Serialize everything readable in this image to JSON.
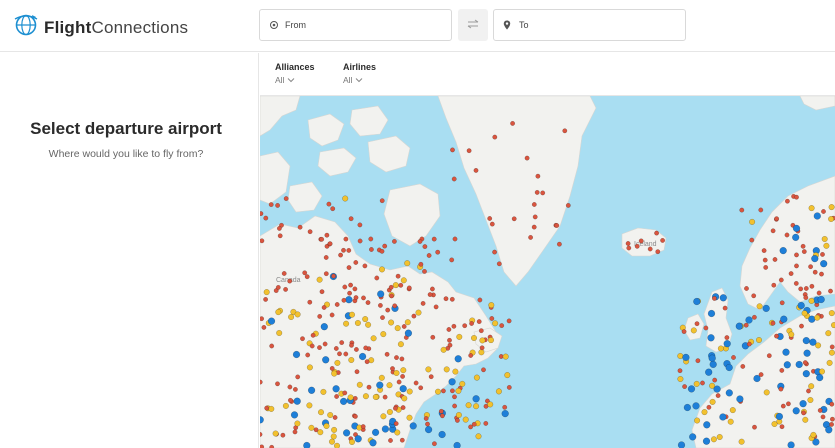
{
  "header": {
    "logo_bold": "Flight",
    "logo_light": "Connections",
    "from_placeholder": "From",
    "to_placeholder": "To"
  },
  "filters": {
    "alliances_label": "Alliances",
    "alliances_value": "All",
    "airlines_label": "Airlines",
    "airlines_value": "All"
  },
  "sidebar": {
    "title": "Select departure airport",
    "subtitle": "Where would you like to fly from?"
  },
  "map": {
    "labels": {
      "canada": "Canada",
      "iceland": "Iceland"
    },
    "colors": {
      "ocean": "#a9def2",
      "land": "#f2f2ef",
      "airport_small": "#d9553f",
      "airport_medium": "#f2c12e",
      "airport_large": "#1e7fd8",
      "accent": "#1d8fd1"
    }
  }
}
